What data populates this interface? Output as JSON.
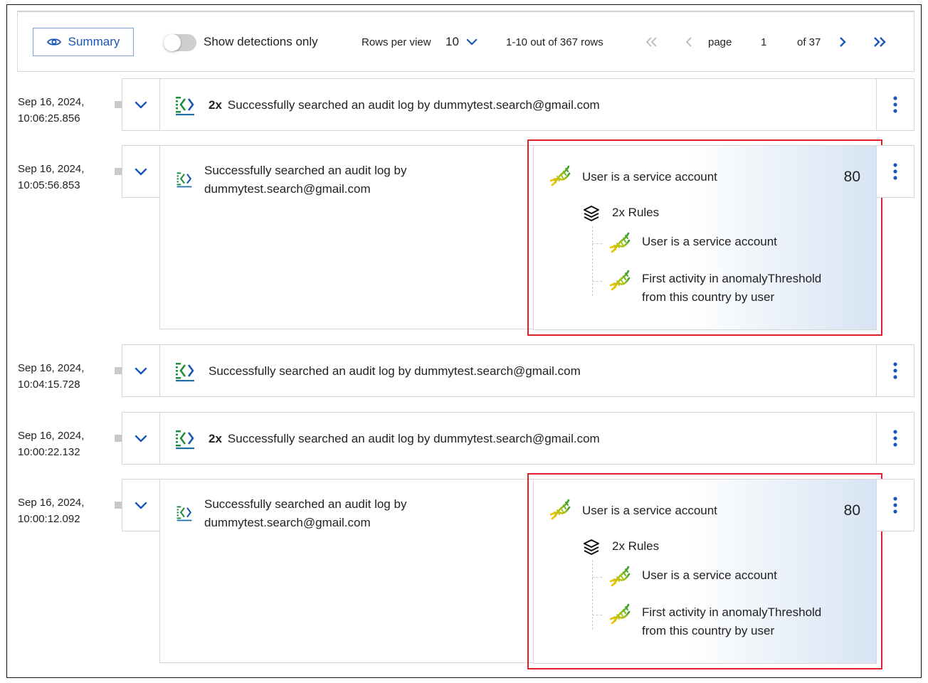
{
  "toolbar": {
    "summary_label": "Summary",
    "summary_icon": "eye-icon",
    "toggle_label": "Show detections only",
    "toggle_on": false,
    "rows_per_view_label": "Rows per view",
    "rows_per_view_value": "10",
    "range_text": "1-10 out of 367 rows",
    "page_label": "page",
    "page_current": "1",
    "page_total_text": "of 37"
  },
  "colors": {
    "accent": "#1857b8",
    "highlight_border": "#e0202a",
    "panel_gradient_end": "#d7e4f3"
  },
  "rows": [
    {
      "date": "Sep 16, 2024,",
      "time": "10:06:25.856",
      "count": "2x",
      "message": "Successfully searched an audit log by dummytest.search@gmail.com",
      "icon": "audit-log-icon"
    },
    {
      "date": "Sep 16, 2024,",
      "time": "10:05:56.853",
      "message_line1": "Successfully searched an audit log by",
      "message_line2": "dummytest.search@gmail.com",
      "icon": "audit-log-icon",
      "detection": {
        "title": "User is a service account",
        "score": "80",
        "rules_label": "2x Rules",
        "rules": [
          {
            "line1": "User is a service account",
            "line2": ""
          },
          {
            "line1": "First activity in anomalyThreshold",
            "line2": "from this country by user"
          }
        ]
      }
    },
    {
      "date": "Sep 16, 2024,",
      "time": "10:04:15.728",
      "count": "",
      "message": "Successfully searched an audit log by dummytest.search@gmail.com",
      "icon": "audit-log-icon"
    },
    {
      "date": "Sep 16, 2024,",
      "time": "10:00:22.132",
      "count": "2x",
      "message": "Successfully searched an audit log by dummytest.search@gmail.com",
      "icon": "audit-log-icon"
    },
    {
      "date": "Sep 16, 2024,",
      "time": "10:00:12.092",
      "message_line1": "Successfully searched an audit log by",
      "message_line2": "dummytest.search@gmail.com",
      "icon": "audit-log-icon",
      "detection": {
        "title": "User is a service account",
        "score": "80",
        "rules_label": "2x Rules",
        "rules": [
          {
            "line1": "User is a service account",
            "line2": ""
          },
          {
            "line1": "First activity in anomalyThreshold",
            "line2": "from this country by user"
          }
        ]
      }
    }
  ]
}
